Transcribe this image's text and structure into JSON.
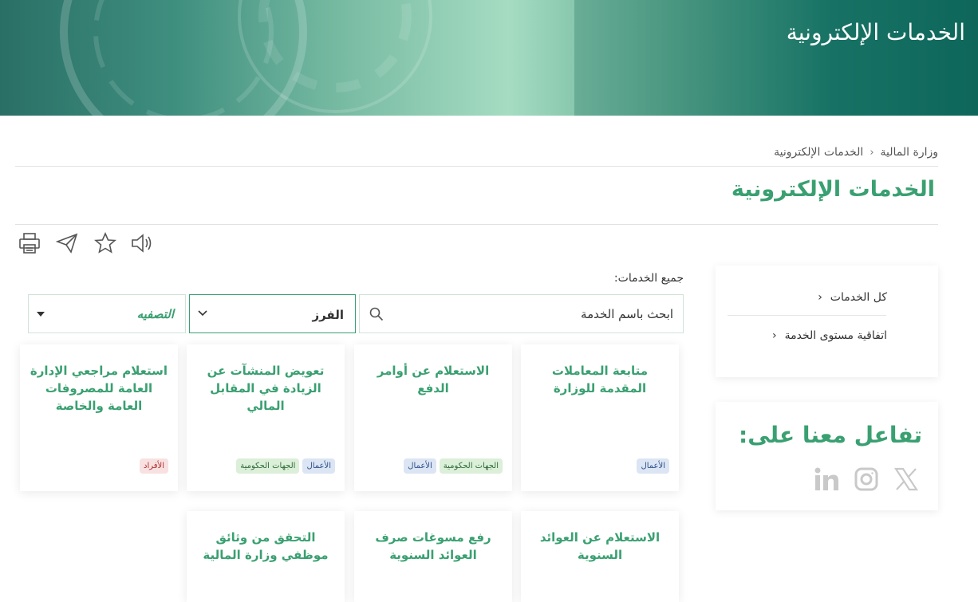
{
  "hero": {
    "title": "الخدمات الإلكترونية"
  },
  "breadcrumb": {
    "home": "وزارة المالية",
    "current": "الخدمات الإلكترونية"
  },
  "page": {
    "title": "الخدمات الإلكترونية"
  },
  "tools": [
    "print-icon",
    "share-icon",
    "favorite-icon",
    "audio-icon"
  ],
  "side_menu": {
    "items": [
      {
        "label": "كل الخدمات"
      },
      {
        "label": "اتفاقية مستوى الخدمة"
      }
    ]
  },
  "social": {
    "title": "تفاعل معنا على:",
    "icons": [
      "x-icon",
      "instagram-icon",
      "linkedin-icon"
    ]
  },
  "services": {
    "label": "جميع الخدمات:",
    "search_placeholder": "ابحث باسم الخدمة",
    "sort_value": "الفرز",
    "filter_value": "التصفيه"
  },
  "cards": [
    {
      "title": "متابعة المعاملات المقدمة للوزارة",
      "tags": [
        {
          "text": "الأعمال",
          "kind": "biz"
        }
      ]
    },
    {
      "title": "الاستعلام عن أوامر الدفع",
      "tags": [
        {
          "text": "الجهات الحكومية",
          "kind": "gov"
        },
        {
          "text": "الأعمال",
          "kind": "biz"
        }
      ]
    },
    {
      "title": "تعويض المنشآت عن الزيادة في المقابل المالي",
      "tags": [
        {
          "text": "الأعمال",
          "kind": "biz"
        },
        {
          "text": "الجهات الحكومية",
          "kind": "gov"
        }
      ]
    },
    {
      "title": "استعلام مراجعي الإدارة العامة للمصروفات العامة والخاصة",
      "tags": [
        {
          "text": "الأفراد",
          "kind": "ind"
        }
      ]
    },
    {
      "title": "الاستعلام عن العوائد السنوية",
      "tags": []
    },
    {
      "title": "رفع مسوغات صرف العوائد السنوية",
      "tags": []
    },
    {
      "title": "التحقق من وثائق موظفي وزارة المالية",
      "tags": []
    }
  ],
  "colors": {
    "accent": "#3aa071",
    "hero_dark": "#0f6a5e"
  }
}
